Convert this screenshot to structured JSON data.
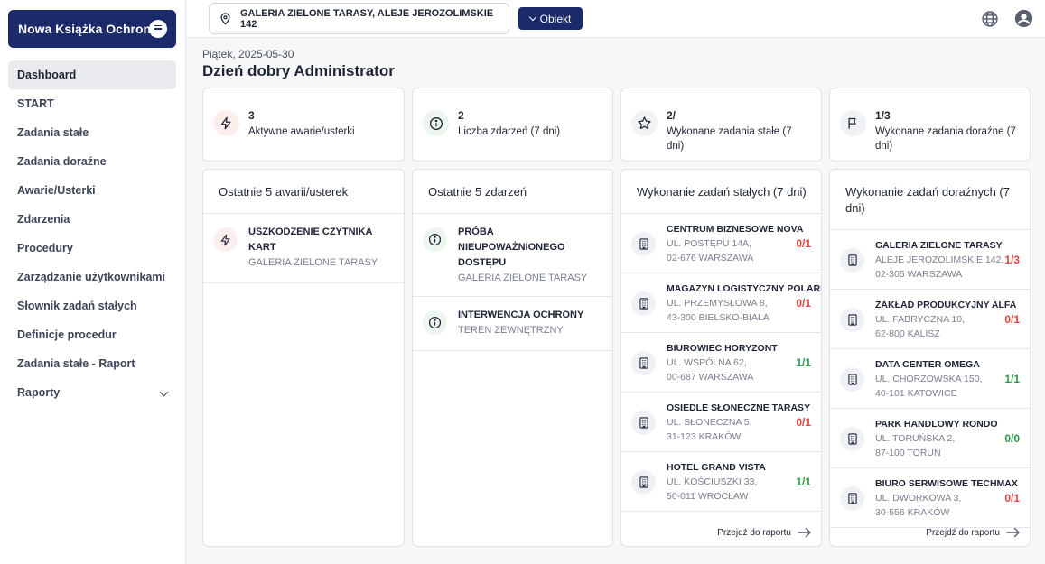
{
  "sidebar": {
    "brand": "Nowa Książka Ochrony",
    "items": [
      {
        "label": "Dashboard"
      },
      {
        "label": "START"
      },
      {
        "label": "Zadania stałe"
      },
      {
        "label": "Zadania doraźne"
      },
      {
        "label": "Awarie/Usterki"
      },
      {
        "label": "Zdarzenia"
      },
      {
        "label": "Procedury"
      },
      {
        "label": "Zarządzanie użytkownikami"
      },
      {
        "label": "Słownik zadań stałych"
      },
      {
        "label": "Definicje procedur"
      },
      {
        "label": "Zadania stałe - Raport"
      },
      {
        "label": "Raporty"
      }
    ]
  },
  "topbar": {
    "location": "GALERIA ZIELONE TARASY, ALEJE JEROZOLIMSKIE 142",
    "obiekt_label": "Obiekt"
  },
  "header": {
    "date": "Piątek, 2025-05-30",
    "greeting": "Dzień dobry Administrator"
  },
  "stats": [
    {
      "value": "3",
      "label": "Aktywne awarie/usterki",
      "icon": "bolt-icon"
    },
    {
      "value": "2",
      "label": "Liczba zdarzeń (7 dni)",
      "icon": "info-icon"
    },
    {
      "value": "2/",
      "label": "Wykonane zadania stałe (7 dni)",
      "icon": "star-icon"
    },
    {
      "value": "1/3",
      "label": "Wykonane zadania doraźne (7 dni)",
      "icon": "flag-icon"
    }
  ],
  "failures": {
    "title": "Ostatnie 5 awarii/usterek",
    "items": [
      {
        "title": "USZKODZENIE CZYTNIKA KART",
        "sub": "GALERIA ZIELONE TARASY"
      }
    ]
  },
  "events": {
    "title": "Ostatnie 5 zdarzeń",
    "items": [
      {
        "title": "PRÓBA NIEUPOWAŻNIONEGO DOSTĘPU",
        "sub": "GALERIA ZIELONE TARASY"
      },
      {
        "title": "INTERWENCJA OCHRONY",
        "sub": "TEREN ZEWNĘTRZNY"
      }
    ]
  },
  "fixed_tasks": {
    "title": "Wykonanie zadań stałych (7 dni)",
    "link": "Przejdź do raportu",
    "items": [
      {
        "name": "CENTRUM BIZNESOWE NOVA",
        "addr1": "UL. POSTĘPU 14A,",
        "addr2": "02-676 WARSZAWA",
        "count": "0/1",
        "status": "red"
      },
      {
        "name": "MAGAZYN LOGISTYCZNY POLARIS",
        "addr1": "UL. PRZEMYSŁOWA 8,",
        "addr2": "43-300 BIELSKO-BIAŁA",
        "count": "0/1",
        "status": "red"
      },
      {
        "name": "BIUROWIEC HORYZONT",
        "addr1": "UL. WSPÓLNA 62,",
        "addr2": "00-687 WARSZAWA",
        "count": "1/1",
        "status": "green"
      },
      {
        "name": "OSIEDLE SŁONECZNE TARASY",
        "addr1": "UL. SŁONECZNA 5,",
        "addr2": "31-123 KRAKÓW",
        "count": "0/1",
        "status": "red"
      },
      {
        "name": "HOTEL GRAND VISTA",
        "addr1": "UL. KOŚCIUSZKI 33,",
        "addr2": "50-011 WROCŁAW",
        "count": "1/1",
        "status": "green"
      }
    ]
  },
  "adhoc_tasks": {
    "title": "Wykonanie zadań doraźnych (7 dni)",
    "link": "Przejdź do raportu",
    "items": [
      {
        "name": "GALERIA ZIELONE TARASY",
        "addr1": "ALEJE JEROZOLIMSKIE 142,",
        "addr2": "02-305 WARSZAWA",
        "count": "1/3",
        "status": "red"
      },
      {
        "name": "ZAKŁAD PRODUKCYJNY ALFA",
        "addr1": "UL. FABRYCZNA 10,",
        "addr2": "62-800 KALISZ",
        "count": "0/1",
        "status": "red"
      },
      {
        "name": "DATA CENTER OMEGA",
        "addr1": "UL. CHORZOWSKA 150,",
        "addr2": "40-101 KATOWICE",
        "count": "1/1",
        "status": "green"
      },
      {
        "name": "PARK HANDLOWY RONDO",
        "addr1": "UL. TORUŃSKA 2,",
        "addr2": "87-100 TORUŃ",
        "count": "0/0",
        "status": "green"
      },
      {
        "name": "BIURO SERWISOWE TECHMAX",
        "addr1": "UL. DWORKOWA 3,",
        "addr2": "30-556 KRAKÓW",
        "count": "0/1",
        "status": "red"
      }
    ]
  }
}
